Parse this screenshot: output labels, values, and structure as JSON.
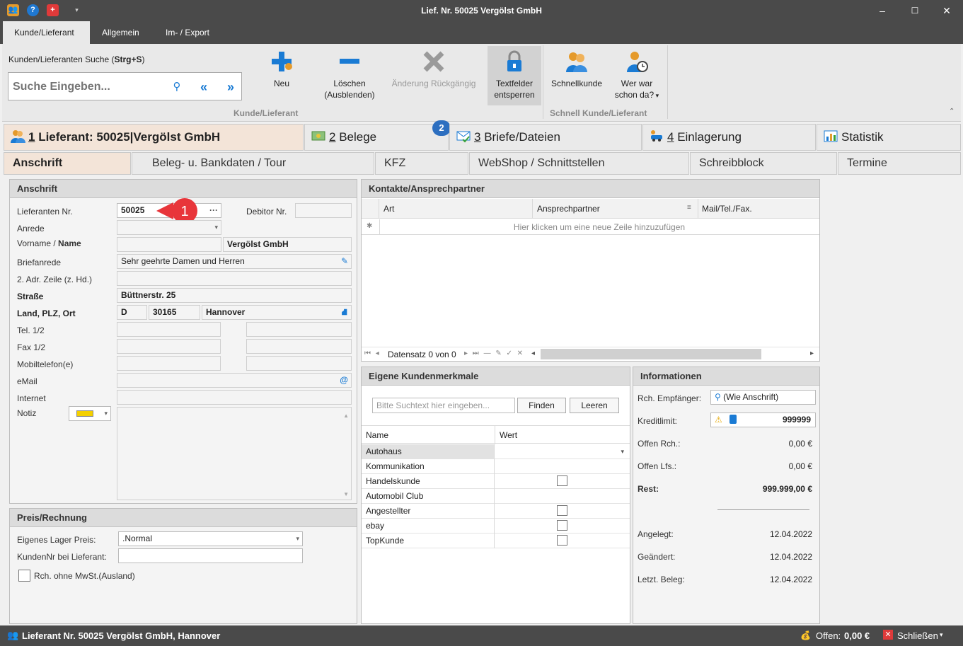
{
  "window": {
    "title": "Lief. Nr. 50025 Vergölst GmbH",
    "minimize": "–",
    "maximize": "☐",
    "close": "✕"
  },
  "ribbon_tabs": [
    "Kunde/Lieferant",
    "Allgemein",
    "Im- / Export"
  ],
  "ribbon": {
    "search_label_prefix": "Kunden/Lieferanten Suche (",
    "search_shortcut": "Strg+S",
    "search_label_suffix": ")",
    "search_placeholder": "Suche Eingeben...",
    "btn_new": "Neu",
    "btn_delete_1": "Löschen",
    "btn_delete_2": "(Ausblenden)",
    "btn_undo": "Änderung Rückgängig",
    "btn_unlock_1": "Textfelder",
    "btn_unlock_2": "entsperren",
    "group1": "Kunde/Lieferant",
    "btn_quick": "Schnellkunde",
    "btn_who_1": "Wer war",
    "btn_who_2": "schon da?",
    "group2": "Schnell Kunde/Lieferant"
  },
  "main_tabs": [
    {
      "num": "1",
      "label": " Lieferant: 50025|Vergölst GmbH"
    },
    {
      "num": "2",
      "label": " Belege"
    },
    {
      "num": "3",
      "label": " Briefe/Dateien"
    },
    {
      "num": "4",
      "label": " Einlagerung"
    },
    {
      "num": "",
      "label": "Statistik"
    }
  ],
  "belege_badge": "2",
  "sub_tabs": [
    "Anschrift",
    "Beleg- u. Bankdaten / Tour",
    "KFZ",
    "WebShop / Schnittstellen",
    "Schreibblock",
    "Termine"
  ],
  "anschrift": {
    "title": "Anschrift",
    "lief_nr_label": "Lieferanten Nr.",
    "lief_nr": "50025",
    "dots": "···",
    "marker": "1",
    "debitor_label": "Debitor Nr.",
    "anrede_label": "Anrede",
    "vorname_label": "Vorname / ",
    "name_label": "Name",
    "name": "Vergölst GmbH",
    "briefanrede_label": "Briefanrede",
    "briefanrede": "Sehr geehrte Damen und Herren",
    "adr2_label": "2. Adr. Zeile (z. Hd.)",
    "strasse_label": "Straße",
    "strasse": "Büttnerstr. 25",
    "ort_label": "Land, PLZ, Ort",
    "land": "D",
    "plz": "30165",
    "ort": "Hannover",
    "tel_label": "Tel. 1/2",
    "fax_label": "Fax 1/2",
    "mobil_label": "Mobiltelefon(e)",
    "email_label": "eMail",
    "internet_label": "Internet",
    "notiz_label": "Notiz"
  },
  "preis": {
    "title": "Preis/Rechnung",
    "lager_label": "Eigenes Lager Preis:",
    "lager_value": ".Normal",
    "kdnr_label": "KundenNr bei Lieferant:",
    "mwst_label": "Rch. ohne MwSt.(Ausland)"
  },
  "kontakte": {
    "title": "Kontakte/Ansprechpartner",
    "columns": [
      "Art",
      "Ansprechpartner",
      "Mail/Tel./Fax."
    ],
    "new_row": "Hier klicken um eine neue Zeile hinzuzufügen",
    "nav_text": "Datensatz 0 von 0"
  },
  "merkmale": {
    "title": "Eigene Kundenmerkmale",
    "search_placeholder": "Bitte Suchtext hier eingeben...",
    "find": "Finden",
    "clear": "Leeren",
    "col_name": "Name",
    "col_wert": "Wert",
    "rows": [
      {
        "name": "Autohaus",
        "type": "dropdown"
      },
      {
        "name": "Kommunikation",
        "type": "text"
      },
      {
        "name": "Handelskunde",
        "type": "check"
      },
      {
        "name": "Automobil Club",
        "type": "text"
      },
      {
        "name": "Angestellter",
        "type": "check"
      },
      {
        "name": "ebay",
        "type": "check"
      },
      {
        "name": "TopKunde",
        "type": "check"
      }
    ]
  },
  "info": {
    "title": "Informationen",
    "rch_label": "Rch. Empfänger:",
    "rch_value": "(Wie Anschrift)",
    "kredit_label": "Kreditlimit:",
    "kredit_value": "999999",
    "offen_rch_label": "Offen Rch.:",
    "offen_rch": "0,00 €",
    "offen_lfs_label": "Offen Lfs.:",
    "offen_lfs": "0,00 €",
    "rest_label": "Rest:",
    "rest": "999.999,00 €",
    "angelegt_label": "Angelegt:",
    "angelegt": "12.04.2022",
    "geaendert_label": "Geändert:",
    "geaendert": "12.04.2022",
    "letzt_label": "Letzt. Beleg:",
    "letzt": "12.04.2022"
  },
  "status": {
    "text": "Lieferant Nr. 50025 Vergölst GmbH, Hannover",
    "offen_label": "Offen:",
    "offen_value": "0,00 €",
    "close": "Schließen"
  },
  "colors": {
    "accent": "#1a7bd4",
    "tab_active": "#f3e4d8",
    "badge": "#2d6fc0",
    "marker": "#e8353a"
  }
}
